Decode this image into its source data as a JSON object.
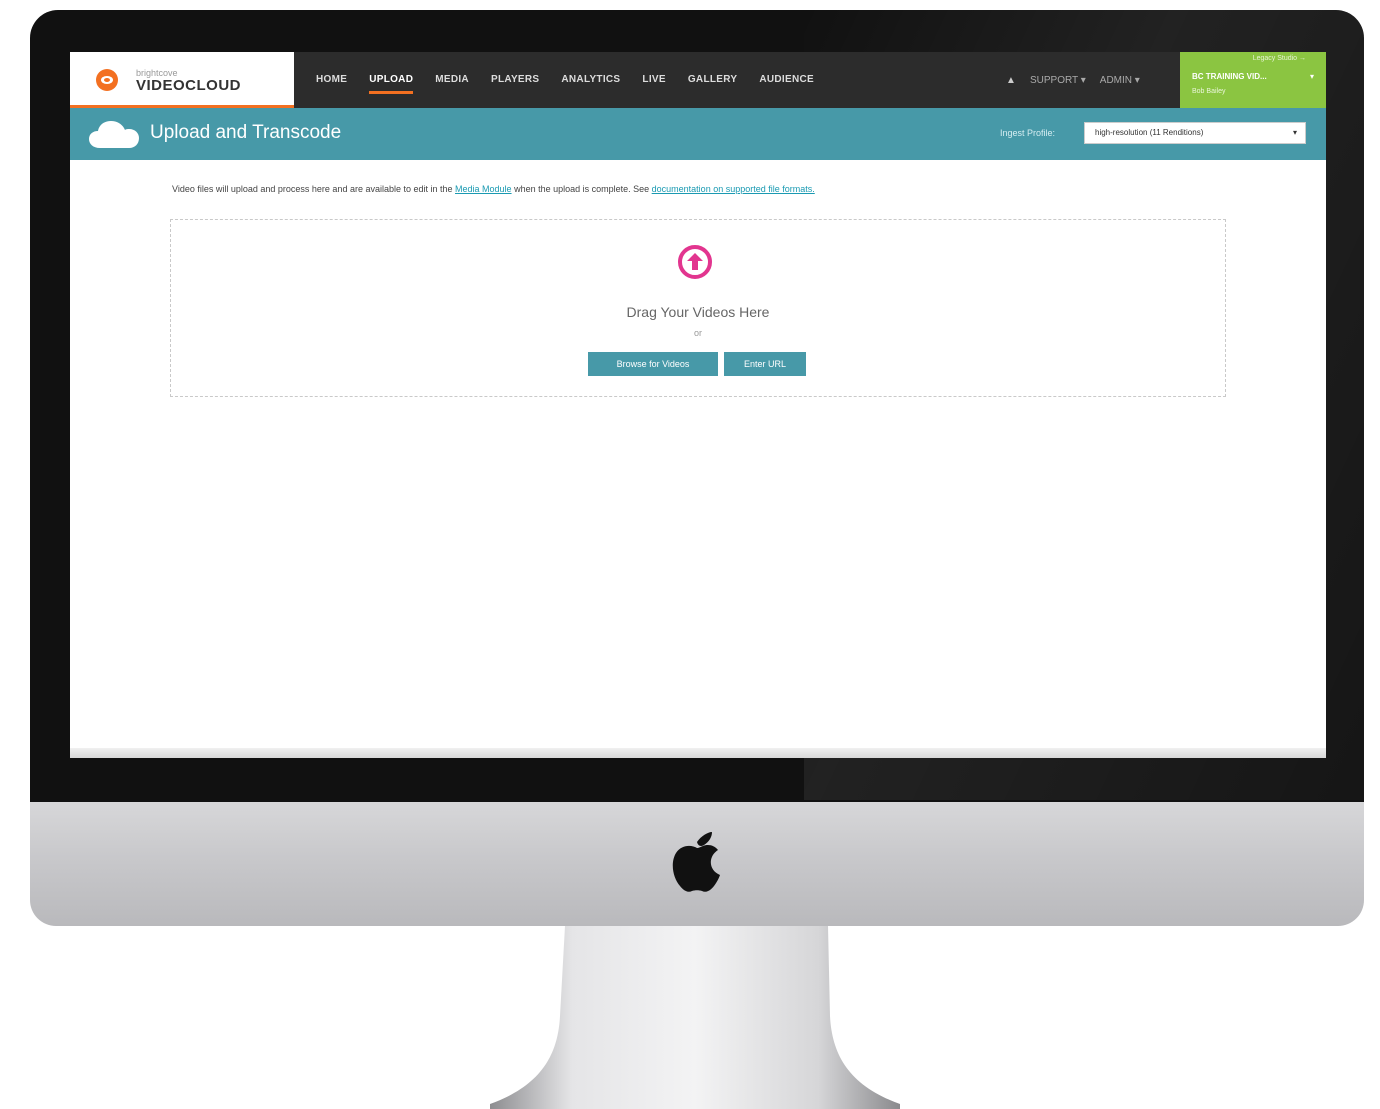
{
  "app": {
    "brand_small": "brightcove",
    "brand_main": "VIDEOCLOUD"
  },
  "nav": {
    "items": [
      {
        "label": "HOME",
        "active": false
      },
      {
        "label": "UPLOAD",
        "active": true
      },
      {
        "label": "MEDIA",
        "active": false
      },
      {
        "label": "PLAYERS",
        "active": false
      },
      {
        "label": "ANALYTICS",
        "active": false
      },
      {
        "label": "LIVE",
        "active": false
      },
      {
        "label": "GALLERY",
        "active": false
      },
      {
        "label": "AUDIENCE",
        "active": false
      }
    ],
    "support": "SUPPORT ▾",
    "admin": "ADMIN ▾",
    "account": {
      "top_link": "Legacy Studio →",
      "name": "BC TRAINING VID...",
      "user": "Bob Bailey",
      "caret": "▾"
    }
  },
  "header": {
    "title": "Upload and Transcode",
    "profile_label": "Ingest Profile:",
    "profile_value": "high-resolution (11 Renditions)"
  },
  "intro": {
    "text_before": "Video files will upload and process here and are available to edit in the ",
    "link1": "Media Module",
    "text_middle": " when the upload is complete. See ",
    "link2": "documentation on supported file formats."
  },
  "dropzone": {
    "drag_text": "Drag Your Videos Here",
    "or_text": "or",
    "browse_button": "Browse for Videos",
    "url_button": "Enter URL"
  },
  "colors": {
    "accent_orange": "#f37021",
    "teal": "#4799a8",
    "account_green": "#8bc541",
    "upload_pink": "#e2358f"
  }
}
